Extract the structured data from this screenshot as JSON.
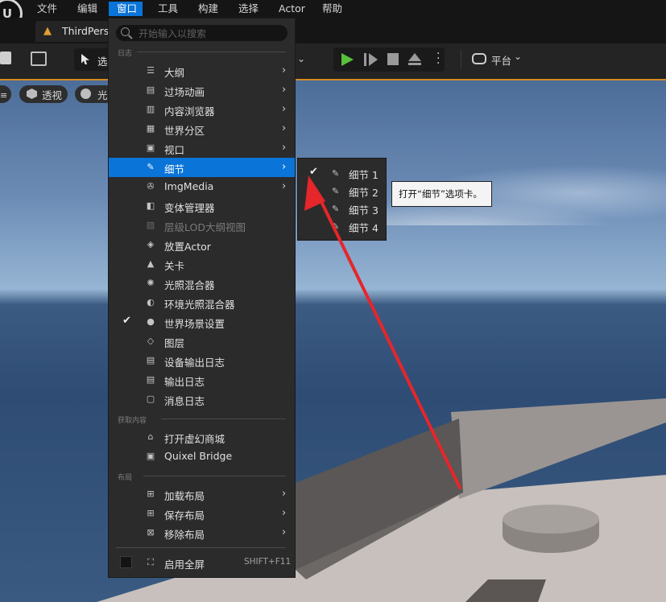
{
  "menubar": {
    "logo": "U",
    "items": [
      {
        "label": "文件"
      },
      {
        "label": "编辑"
      },
      {
        "label": "窗口"
      },
      {
        "label": "工具"
      },
      {
        "label": "构建"
      },
      {
        "label": "选择"
      },
      {
        "label": "Actor"
      },
      {
        "label": "帮助"
      }
    ]
  },
  "tab": {
    "label": "ThirdPers"
  },
  "toolbar": {
    "select_mode_label": "选",
    "platform_label": "平台"
  },
  "viewport": {
    "perspective_label": "透视",
    "lit_label": "光"
  },
  "window_menu": {
    "search_placeholder": "开始输入以搜索",
    "sections": {
      "log": "日志",
      "get_content": "获取内容",
      "layout": "布局"
    },
    "items": [
      {
        "label": "大纲",
        "icon": "outline-icon"
      },
      {
        "label": "过场动画",
        "icon": "clapper-icon"
      },
      {
        "label": "内容浏览器",
        "icon": "content-browser-icon"
      },
      {
        "label": "世界分区",
        "icon": "grid-icon"
      },
      {
        "label": "视口",
        "icon": "viewport-icon"
      },
      {
        "label": "细节",
        "icon": "pencil-icon"
      },
      {
        "label": "ImgMedia",
        "icon": "film-reel-icon"
      },
      {
        "label": "变体管理器",
        "icon": "book-icon"
      },
      {
        "label": "层级LOD大纲视图",
        "icon": "lod-icon"
      },
      {
        "label": "放置Actor",
        "icon": "place-actor-icon"
      },
      {
        "label": "关卡",
        "icon": "level-icon"
      },
      {
        "label": "光照混合器",
        "icon": "light-icon"
      },
      {
        "label": "环境光照混合器",
        "icon": "env-light-icon"
      },
      {
        "label": "世界场景设置",
        "icon": "globe-icon"
      },
      {
        "label": "图层",
        "icon": "layers-icon"
      },
      {
        "label": "设备输出日志",
        "icon": "device-log-icon"
      },
      {
        "label": "输出日志",
        "icon": "output-log-icon"
      },
      {
        "label": "消息日志",
        "icon": "message-log-icon"
      },
      {
        "label": "打开虚幻商城",
        "icon": "marketplace-icon"
      },
      {
        "label": "Quixel Bridge",
        "icon": "bridge-icon"
      },
      {
        "label": "加载布局",
        "icon": "load-layout-icon"
      },
      {
        "label": "保存布局",
        "icon": "save-layout-icon"
      },
      {
        "label": "移除布局",
        "icon": "remove-layout-icon"
      },
      {
        "label": "启用全屏",
        "icon": "fullscreen-icon",
        "shortcut": "SHIFT+F11"
      }
    ]
  },
  "details_submenu": {
    "items": [
      {
        "label": "细节 1",
        "checked": true
      },
      {
        "label": "细节 2"
      },
      {
        "label": "细节 3"
      },
      {
        "label": "细节 4"
      }
    ]
  },
  "tooltip": {
    "text": "打开“细节”选项卡。"
  },
  "colors": {
    "accent": "#0a74d8",
    "toolbar_border": "#d28a23",
    "arrow": "#e5262a"
  }
}
